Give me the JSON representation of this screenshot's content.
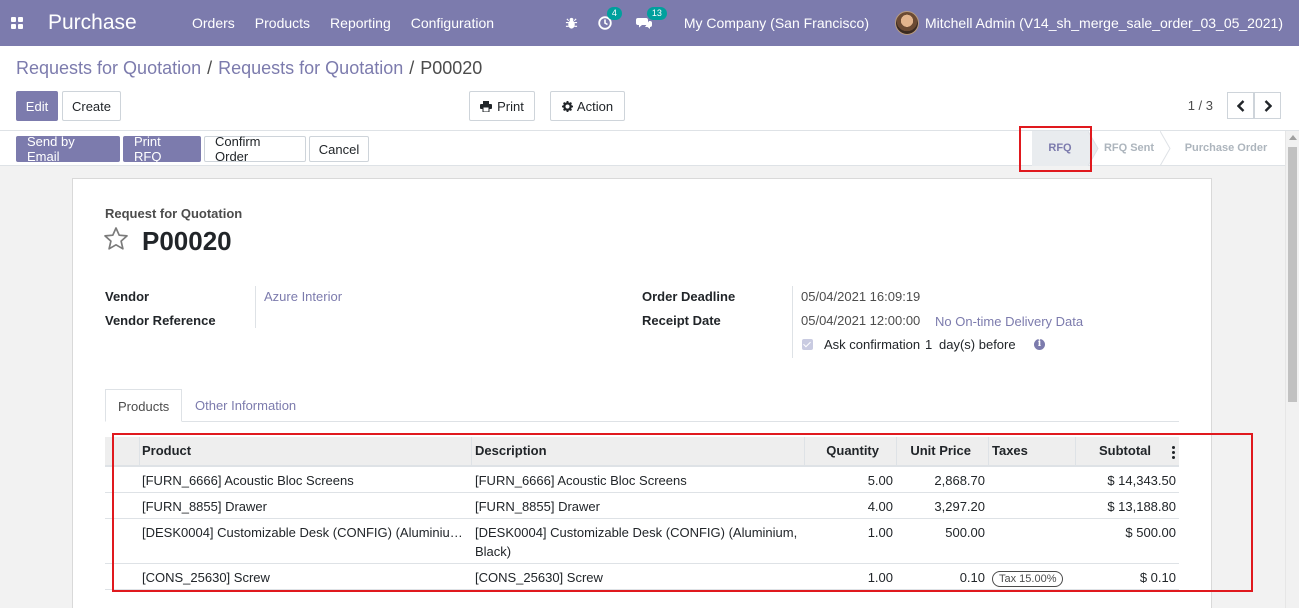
{
  "navbar": {
    "app_name": "Purchase",
    "menu": [
      "Orders",
      "Products",
      "Reporting",
      "Configuration"
    ],
    "activity_count": "4",
    "messages_count": "13",
    "company": "My Company (San Francisco)",
    "user": "Mitchell Admin (V14_sh_merge_sale_order_03_05_2021)"
  },
  "breadcrumb": {
    "first": "Requests for Quotation",
    "second": "Requests for Quotation",
    "current": "P00020",
    "separator": "/"
  },
  "buttons": {
    "edit": "Edit",
    "create": "Create",
    "print": "Print",
    "action": "Action",
    "send_email": "Send by Email",
    "print_rfq": "Print RFQ",
    "confirm": "Confirm Order",
    "cancel": "Cancel"
  },
  "pager": {
    "value": "1 / 3"
  },
  "stages": [
    "RFQ",
    "RFQ Sent",
    "Purchase Order"
  ],
  "form": {
    "doc_type": "Request for Quotation",
    "name": "P00020",
    "vendor_label": "Vendor",
    "vendor_value": "Azure Interior",
    "vendor_ref_label": "Vendor Reference",
    "deadline_label": "Order Deadline",
    "deadline_value": "05/04/2021 16:09:19",
    "receipt_label": "Receipt Date",
    "receipt_value": "05/04/2021 12:00:00",
    "ontime_link": "No On-time Delivery Data",
    "ask_conf_label": "Ask confirmation",
    "ask_conf_days": "1",
    "ask_conf_suffix": "day(s) before"
  },
  "tabs": [
    "Products",
    "Other Information"
  ],
  "table": {
    "headers": {
      "product": "Product",
      "description": "Description",
      "quantity": "Quantity",
      "unit_price": "Unit Price",
      "taxes": "Taxes",
      "subtotal": "Subtotal"
    },
    "rows": [
      {
        "product": "[FURN_6666] Acoustic Bloc Screens",
        "description": "[FURN_6666] Acoustic Bloc Screens",
        "quantity": "5.00",
        "unit_price": "2,868.70",
        "taxes": "",
        "subtotal": "$ 14,343.50"
      },
      {
        "product": "[FURN_8855] Drawer",
        "description": "[FURN_8855] Drawer",
        "quantity": "4.00",
        "unit_price": "3,297.20",
        "taxes": "",
        "subtotal": "$ 13,188.80"
      },
      {
        "product": "[DESK0004] Customizable Desk (CONFIG) (Aluminiu…",
        "description_l1": "[DESK0004] Customizable Desk (CONFIG) (Aluminium,",
        "description_l2": "Black)",
        "quantity": "1.00",
        "unit_price": "500.00",
        "taxes": "",
        "subtotal": "$ 500.00"
      },
      {
        "product": "[CONS_25630] Screw",
        "description": "[CONS_25630] Screw",
        "quantity": "1.00",
        "unit_price": "0.10",
        "taxes": "Tax 15.00%",
        "subtotal": "$ 0.10"
      }
    ]
  },
  "colors": {
    "brand": "#7c7bad",
    "highlight": "#e0191e",
    "badge": "#00a09d"
  }
}
